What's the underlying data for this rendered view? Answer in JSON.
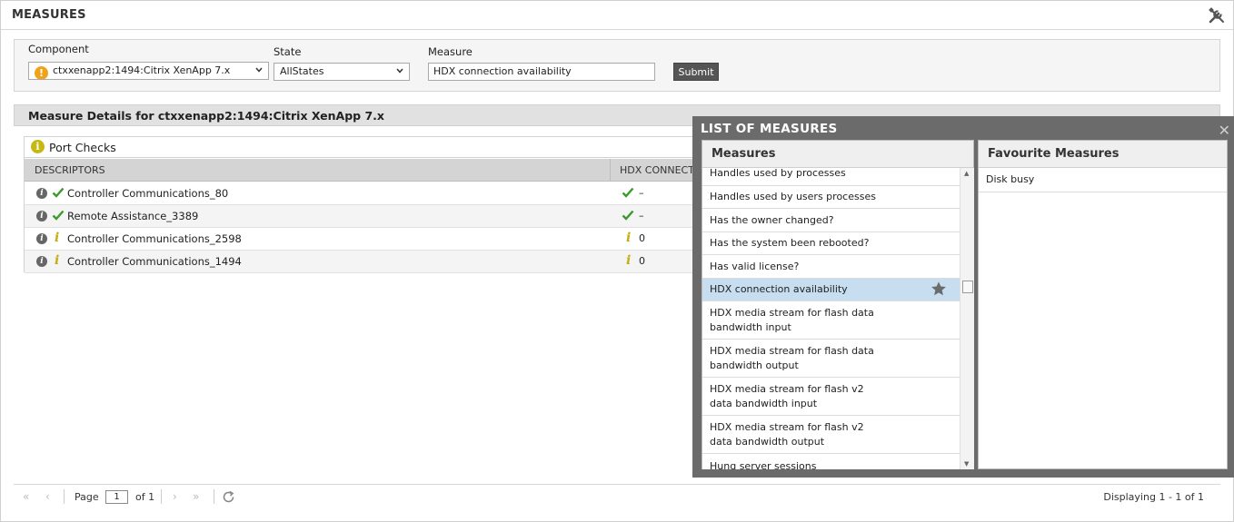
{
  "window": {
    "title": "MEASURES",
    "tools_icon": "wrench-screwdriver-icon"
  },
  "filters": {
    "component_label": "Component",
    "component_value": "ctxxenapp2:1494:Citrix XenApp 7.x",
    "component_status_icon": "warning-icon",
    "state_label": "State",
    "state_value": "AllStates",
    "measure_label": "Measure",
    "measure_value": "HDX connection availability",
    "submit_label": "Submit"
  },
  "details": {
    "title": "Measure Details for ctxxenapp2:1494:Citrix XenApp 7.x",
    "panel_title": "Port Checks",
    "panel_icon_glyph": "i",
    "columns": [
      "DESCRIPTORS",
      "HDX CONNECTI"
    ],
    "rows": [
      {
        "status": "ok",
        "name": "Controller Communications_80",
        "value": "–"
      },
      {
        "status": "info",
        "name": "Remote Assistance_3389",
        "value": "–"
      },
      {
        "status": "info",
        "name": "Controller Communications_2598",
        "value": "0"
      },
      {
        "status": "info",
        "name": "Controller Communications_1494",
        "value": "0"
      }
    ]
  },
  "pager": {
    "page_label": "Page",
    "page_value": "1",
    "of_label": "of 1",
    "display_text": "Displaying 1 - 1 of 1"
  },
  "list_of_measures": {
    "title": "LIST OF MEASURES",
    "close_glyph": "✕",
    "measures_header": "Measures",
    "favourites_header": "Favourite Measures",
    "selected_index": 5,
    "items": [
      "Handles used by processes",
      "Handles used by users processes",
      "Has the owner changed?",
      "Has the system been rebooted?",
      "Has valid license?",
      "HDX connection availability",
      "HDX media stream for flash data bandwidth input",
      "HDX media stream for flash data bandwidth output",
      "HDX media stream for flash v2 data bandwidth input",
      "HDX media stream for flash v2 data bandwidth output",
      "Hung server sessions"
    ],
    "favourites": [
      "Disk busy"
    ]
  },
  "colors": {
    "ok_green": "#3a9a2a",
    "info_yellow": "#c6ad12",
    "warning_orange": "#f0a31a",
    "selected_row": "#c6def0"
  }
}
